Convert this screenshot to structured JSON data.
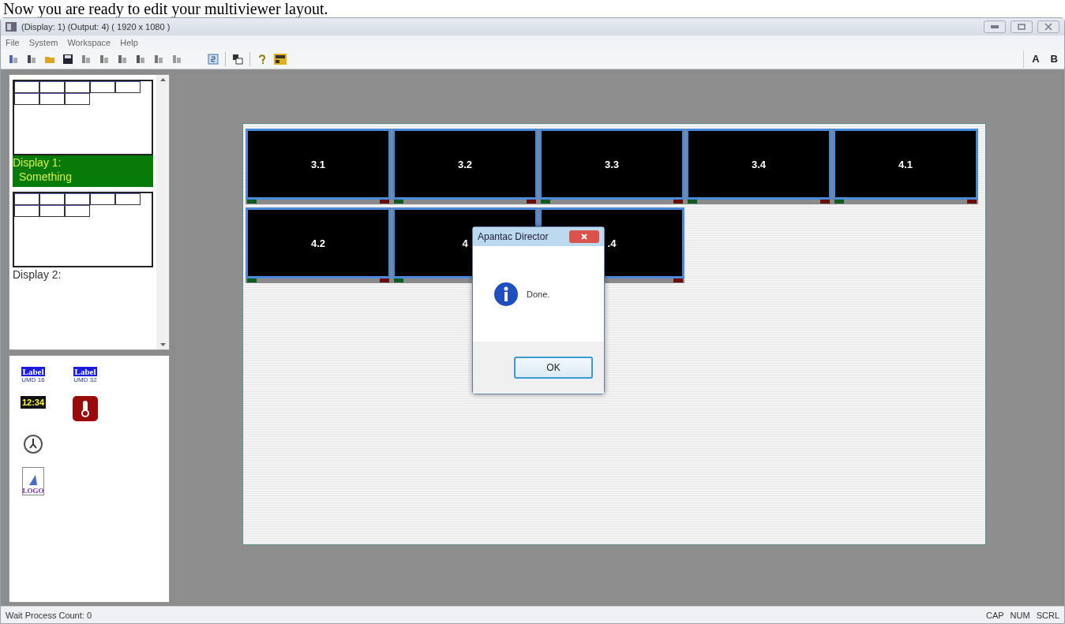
{
  "caption": "Now you are ready to edit your multiviewer layout.",
  "window": {
    "title": "(Display: 1) (Output: 4) ( 1920 x 1080 )"
  },
  "menu": [
    "File",
    "System",
    "Workspace",
    "Help"
  ],
  "toolbar_right": [
    "A",
    "B"
  ],
  "displays": [
    {
      "label": "Display 1:",
      "sublabel": "Something",
      "selected": true
    },
    {
      "label": "Display 2:",
      "selected": false
    }
  ],
  "palette_rows": [
    [
      {
        "kind": "label",
        "text": "Label",
        "caption": "UMD 16"
      },
      {
        "kind": "label",
        "text": "Label",
        "caption": "UMD 32"
      }
    ],
    [
      {
        "kind": "clock",
        "text": "12:34"
      },
      {
        "kind": "thermometer"
      }
    ],
    [
      {
        "kind": "analog-clock"
      }
    ],
    [
      {
        "kind": "logo",
        "text": "LOGO"
      }
    ]
  ],
  "tile_rows": [
    [
      "3.1",
      "3.2",
      "3.3",
      "3.4",
      "4.1"
    ],
    [
      "4.2",
      "4",
      ".4"
    ]
  ],
  "dialog": {
    "title": "Apantac Director",
    "message": "Done.",
    "button": "OK"
  },
  "status_bar": {
    "left": "Wait Process Count: 0",
    "indicators": [
      "CAP",
      "NUM",
      "SCRL"
    ]
  }
}
